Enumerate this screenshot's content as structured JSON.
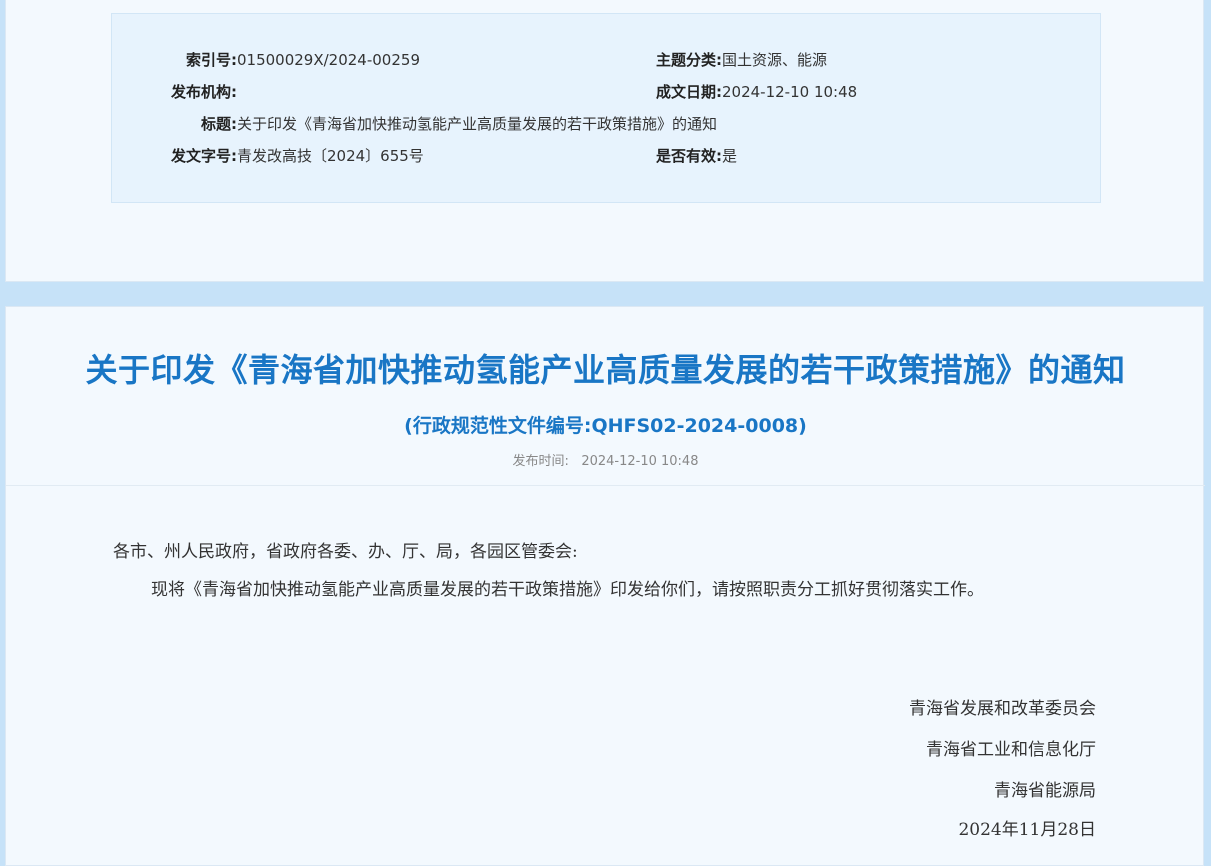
{
  "meta": {
    "index_label": "索引号:",
    "index_value": "01500029X/2024-00259",
    "topic_label": "主题分类:",
    "topic_value": "国土资源、能源",
    "publisher_label": "发布机构:",
    "publisher_value": "",
    "created_label": "成文日期:",
    "created_value": "2024-12-10 10:48",
    "title_label": "标题:",
    "title_value": "关于印发《青海省加快推动氢能产业高质量发展的若干政策措施》的通知",
    "docno_label": "发文字号:",
    "docno_value": "青发改高技〔2024〕655号",
    "valid_label": "是否有效:",
    "valid_value": "是"
  },
  "document": {
    "title": "关于印发《青海省加快推动氢能产业高质量发展的若干政策措施》的通知",
    "subtitle": "(行政规范性文件编号:QHFS02-2024-0008)",
    "publish_label": "发布时间:",
    "publish_date": "2024-12-10 10:48",
    "salutation": "各市、州人民政府，省政府各委、办、厅、局，各园区管委会:",
    "paragraph": "现将《青海省加快推动氢能产业高质量发展的若干政策措施》印发给你们，请按照职责分工抓好贯彻落实工作。",
    "signatures": [
      "青海省发展和改革委员会",
      "青海省工业和信息化厅",
      "青海省能源局"
    ],
    "sign_date": "2024年11月28日"
  },
  "colors": {
    "accent": "#1976c5",
    "page_bg": "#c6e2f8",
    "panel_bg": "#f3f9fe",
    "meta_bg": "#e7f3fd"
  }
}
